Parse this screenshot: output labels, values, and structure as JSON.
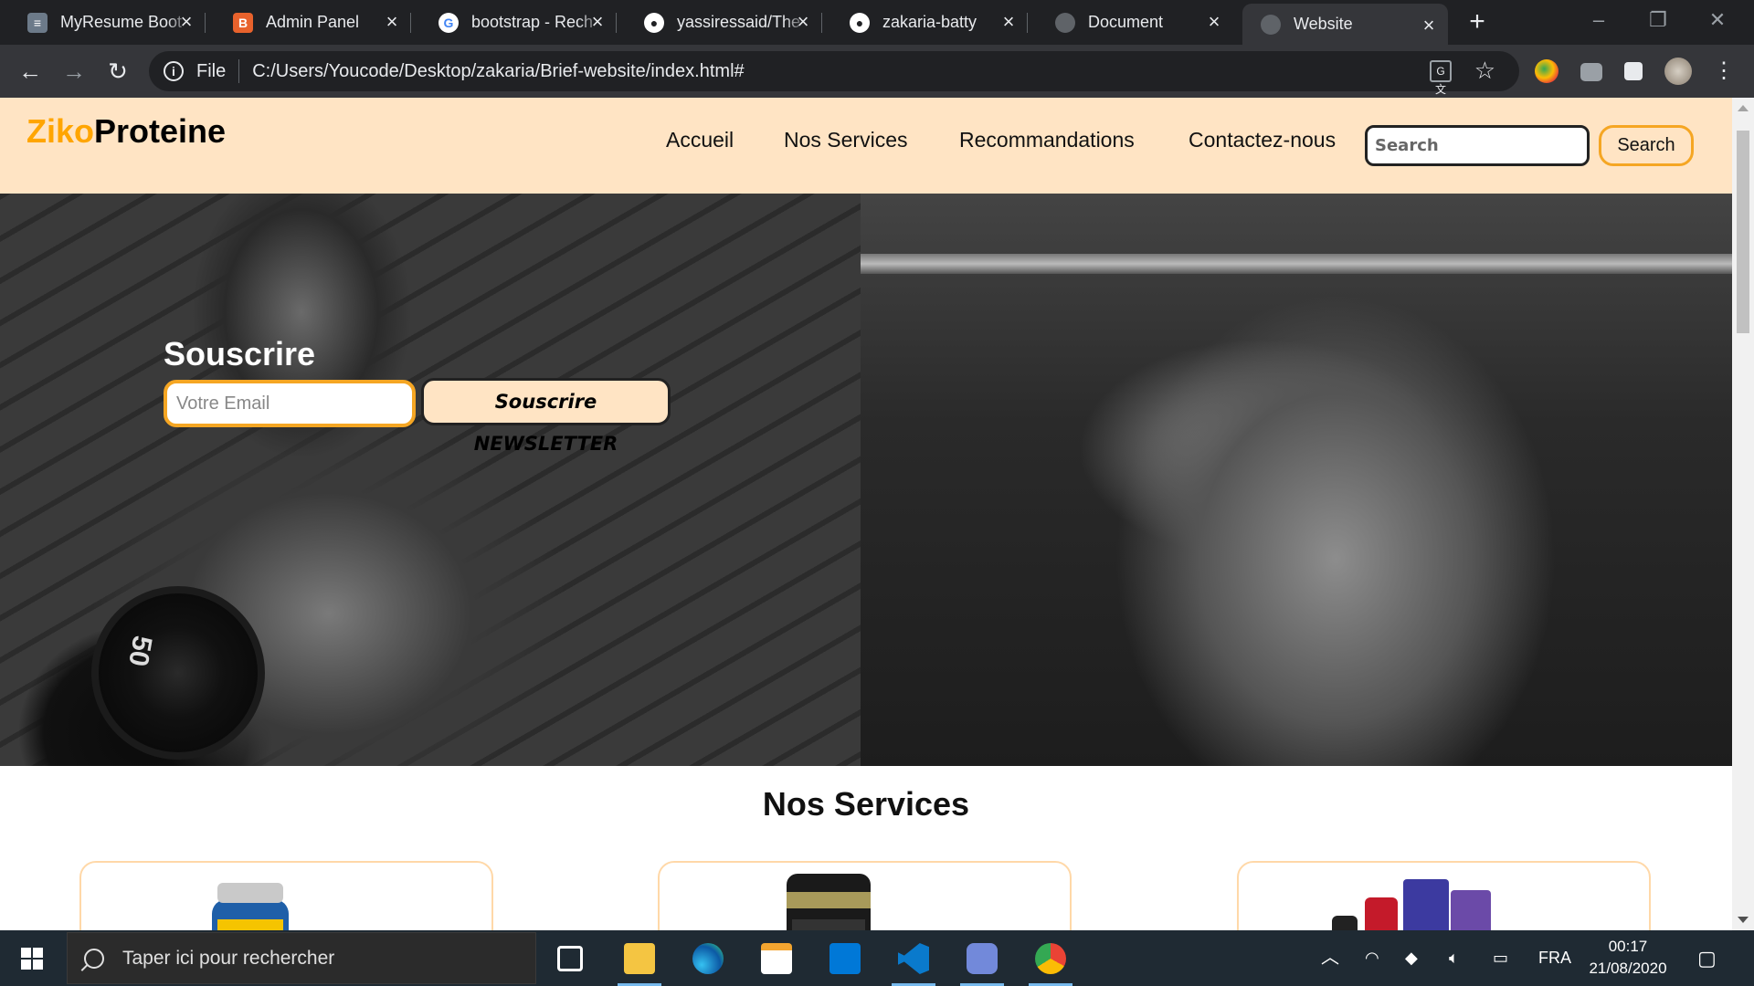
{
  "browser": {
    "tabs": [
      {
        "title": "MyResume Boot",
        "favicon": "resume-favicon",
        "color": "#6c7a89"
      },
      {
        "title": "Admin Panel",
        "favicon": "bootstrap-favicon",
        "color": "#e8622c"
      },
      {
        "title": "bootstrap - Rech",
        "favicon": "google-favicon",
        "color": "#ffffff"
      },
      {
        "title": "yassiressaid/The",
        "favicon": "github-favicon",
        "color": "#ffffff"
      },
      {
        "title": "zakaria-batty",
        "favicon": "github-favicon",
        "color": "#ffffff"
      },
      {
        "title": "Document",
        "favicon": "globe-favicon",
        "color": "#5f6368"
      },
      {
        "title": "Website",
        "favicon": "globe-favicon",
        "color": "#5f6368"
      }
    ],
    "active_tab": 6,
    "new_tab_symbol": "+",
    "address": {
      "scheme_label": "File",
      "url": "C:/Users/Youcode/Desktop/zakaria/Brief-website/index.html#"
    }
  },
  "site": {
    "logo_accent": "Ziko",
    "logo_rest": "Proteine",
    "nav": [
      "Accueil",
      "Nos Services",
      "Recommandations",
      "Contactez-nous"
    ],
    "search_placeholder": "Search",
    "search_button": "Search",
    "hero": {
      "subscribe_title": "Souscrire",
      "email_placeholder": "Votre Email",
      "newsletter_button": "Souscrire NEWSLETTER",
      "dumbbell_text": "50"
    },
    "services_title": "Nos Services",
    "colors": {
      "header_bg": "#ffe4c4",
      "accent": "#ffa500"
    }
  },
  "taskbar": {
    "search_placeholder": "Taper ici pour rechercher",
    "language": "FRA",
    "time": "00:17",
    "date": "21/08/2020"
  }
}
